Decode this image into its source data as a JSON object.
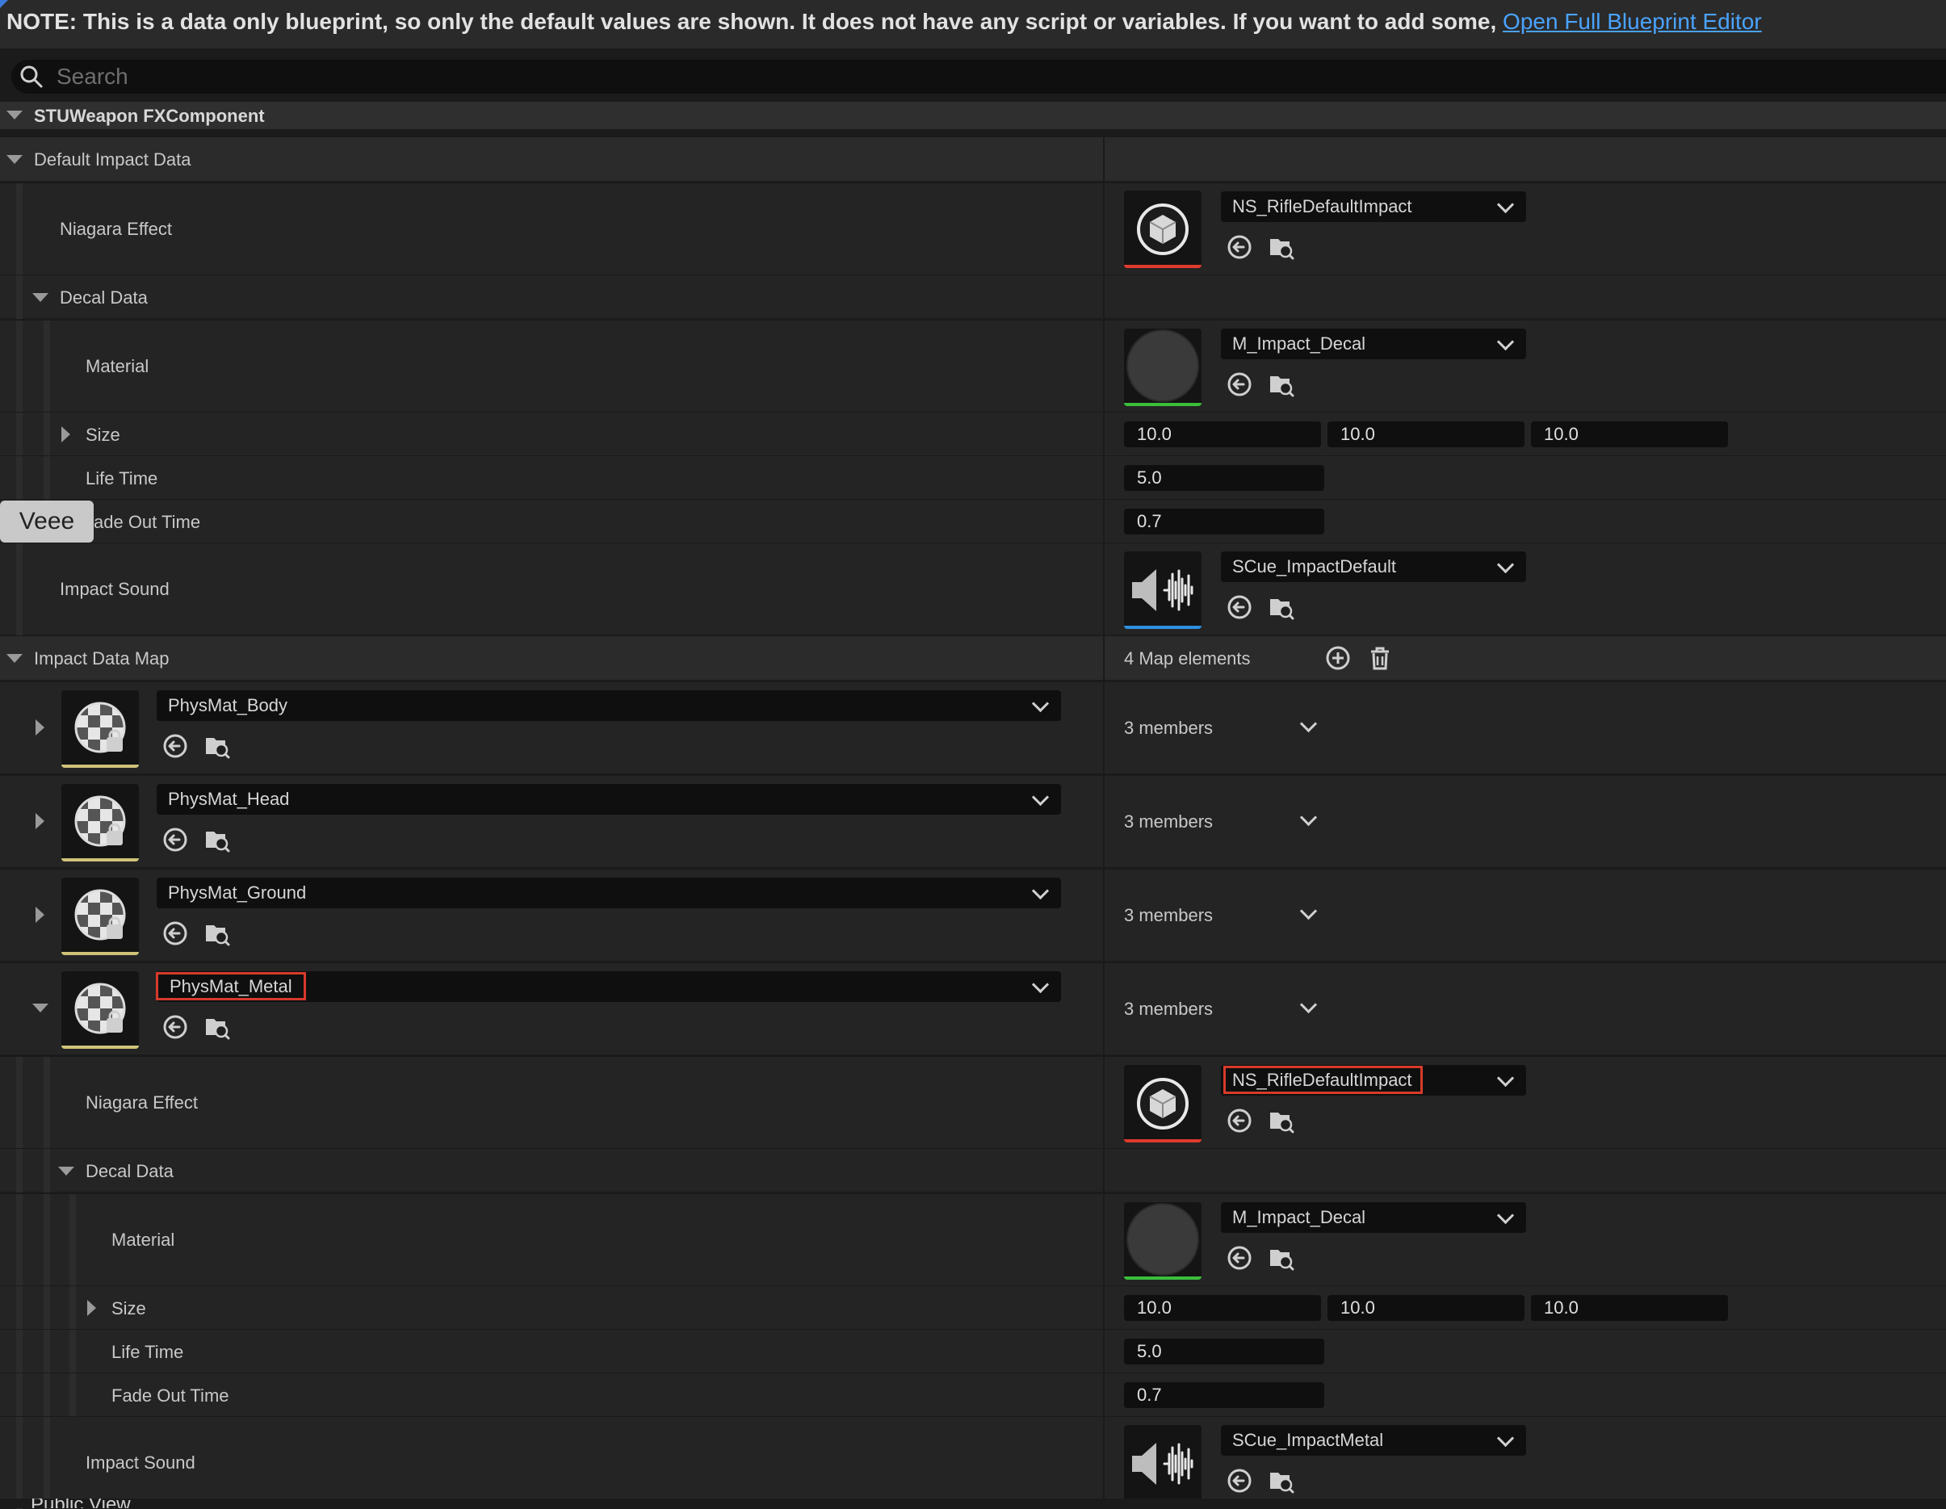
{
  "note": {
    "text": "NOTE: This is a data only blueprint, so only the default values are shown.  It does not have any script or variables.  If you want to add some, ",
    "link": "Open Full Blueprint Editor"
  },
  "search": {
    "placeholder": "Search"
  },
  "component": {
    "title": "STUWeapon FXComponent"
  },
  "default_impact": {
    "title": "Default Impact Data",
    "niagara_label": "Niagara Effect",
    "niagara_value": "NS_RifleDefaultImpact",
    "decal_title": "Decal Data",
    "material_label": "Material",
    "material_value": "M_Impact_Decal",
    "size_label": "Size",
    "size_x": "10.0",
    "size_y": "10.0",
    "size_z": "10.0",
    "life_label": "Life Time",
    "life_value": "5.0",
    "fade_label": "ade Out Time",
    "fade_value": "0.7",
    "sound_label": "Impact Sound",
    "sound_value": "SCue_ImpactDefault"
  },
  "overlay": {
    "veee": "Veee"
  },
  "impact_map": {
    "title": "Impact Data Map",
    "count": "4 Map elements",
    "entries": [
      {
        "key": "PhysMat_Body",
        "members": "3 members"
      },
      {
        "key": "PhysMat_Head",
        "members": "3 members"
      },
      {
        "key": "PhysMat_Ground",
        "members": "3 members"
      },
      {
        "key": "PhysMat_Metal",
        "members": "3 members"
      }
    ],
    "metal": {
      "niagara_label": "Niagara Effect",
      "niagara_value": "NS_RifleDefaultImpact",
      "decal_title": "Decal Data",
      "material_label": "Material",
      "material_value": "M_Impact_Decal",
      "size_label": "Size",
      "size_x": "10.0",
      "size_y": "10.0",
      "size_z": "10.0",
      "life_label": "Life Time",
      "life_value": "5.0",
      "fade_label": "Fade Out Time",
      "fade_value": "0.7",
      "sound_label": "Impact Sound",
      "sound_value": "SCue_ImpactMetal"
    }
  },
  "footer": {
    "text": "Public View"
  },
  "colors": {
    "niagara_underline": "#e03b2c",
    "material_underline": "#3bbf3b",
    "sound_underline": "#2f8fe0",
    "physmat_underline": "#cfc27a",
    "highlight": "#d83a2a",
    "link": "#4aa3ff"
  }
}
